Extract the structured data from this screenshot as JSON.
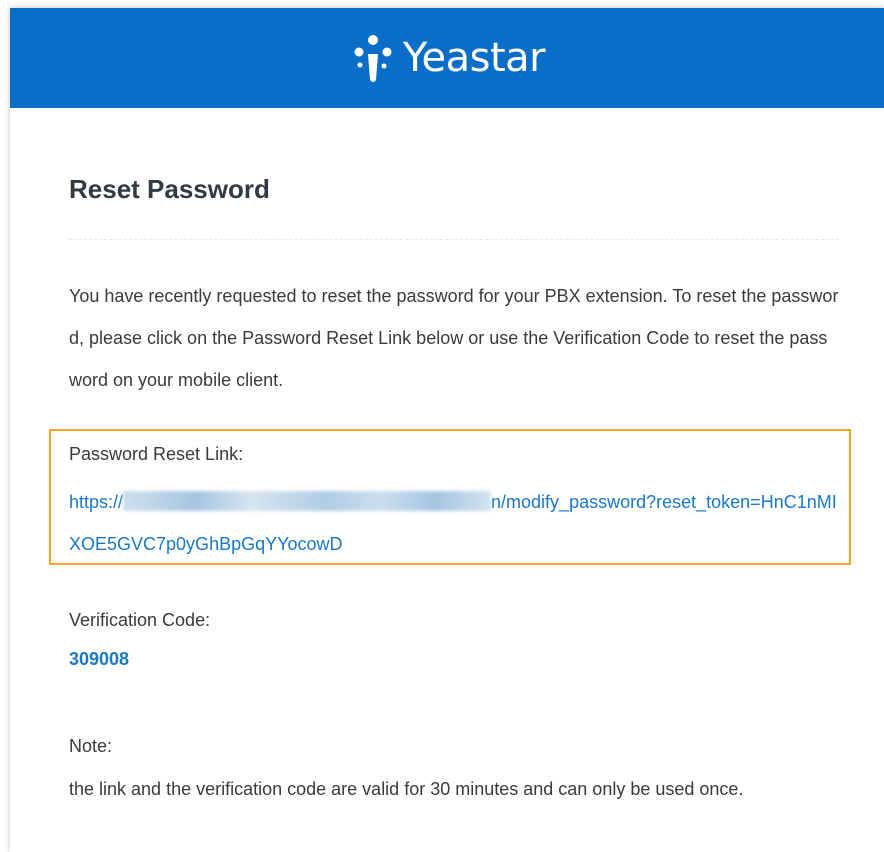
{
  "header": {
    "brand": "Yeastar",
    "logo_icon": "yeastar-logo-mark-icon",
    "background_color": "#0a6ec8"
  },
  "email": {
    "title": "Reset Password",
    "intro": "You have recently requested to reset the password for your PBX extension. To reset the password, please click on the Password Reset Link below or use the Verification Code to reset the password on your mobile client.",
    "reset_link": {
      "label": "Password Reset Link:",
      "prefix": "https://",
      "suffix": "n/modify_password?reset_token=HnC1nMIXOE5GVC7p0yGhBpGqYYocowD"
    },
    "verification": {
      "label": "Verification Code:",
      "code": "309008"
    },
    "note": {
      "label": "Note:",
      "text": "the link and the verification code are valid for 30 minutes and can only be used once."
    }
  },
  "colors": {
    "link": "#1a78c9",
    "highlight_border": "#f2a623",
    "text": "#3a3a3a"
  }
}
